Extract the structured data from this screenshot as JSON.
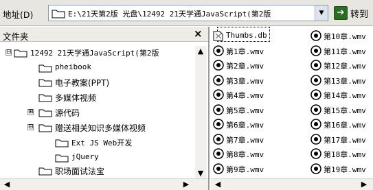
{
  "address_bar": {
    "label": "地址(D)",
    "value": "E:\\21天第2版 光盘\\12492 21天学通JavaScript(第2版",
    "go_label": "转到"
  },
  "folders_pane": {
    "title": "文件夹",
    "close": "×",
    "tree": [
      {
        "label": "12492 21天学通JavaScript(第2版",
        "expander": "⊟"
      },
      {
        "label": "pheibook"
      },
      {
        "label": "电子教案(PPT)"
      },
      {
        "label": "多媒体视频"
      },
      {
        "label": "源代码",
        "expander": "⊞"
      },
      {
        "label": "赠送相关知识多媒体视频",
        "expander": "⊟"
      },
      {
        "label": "Ext JS Web开发"
      },
      {
        "label": "jQuery"
      },
      {
        "label": "职场面试法宝"
      }
    ]
  },
  "files_pane": {
    "column1": [
      "Thumbs.db",
      "第1章.wmv",
      "第2章.wmv",
      "第3章.wmv",
      "第4章.wmv",
      "第5章.wmv",
      "第6章.wmv",
      "第7章.wmv",
      "第8章.wmv",
      "第9章.wmv"
    ],
    "column2": [
      "第10章.wmv",
      "第11章.wmv",
      "第12章.wmv",
      "第13章.wmv",
      "第14章.wmv",
      "第15章.wmv",
      "第16章.wmv",
      "第17章.wmv",
      "第18章.wmv",
      "第19章.wmv"
    ]
  },
  "icons": {
    "folder": "folder-icon",
    "media_file": "windows-media-file-icon",
    "go": "go-arrow-icon"
  },
  "colors": {
    "toolbar_bg": "#e8e6e1",
    "folder_yellow": "#f3d777",
    "go_green": "#2b6b25"
  }
}
